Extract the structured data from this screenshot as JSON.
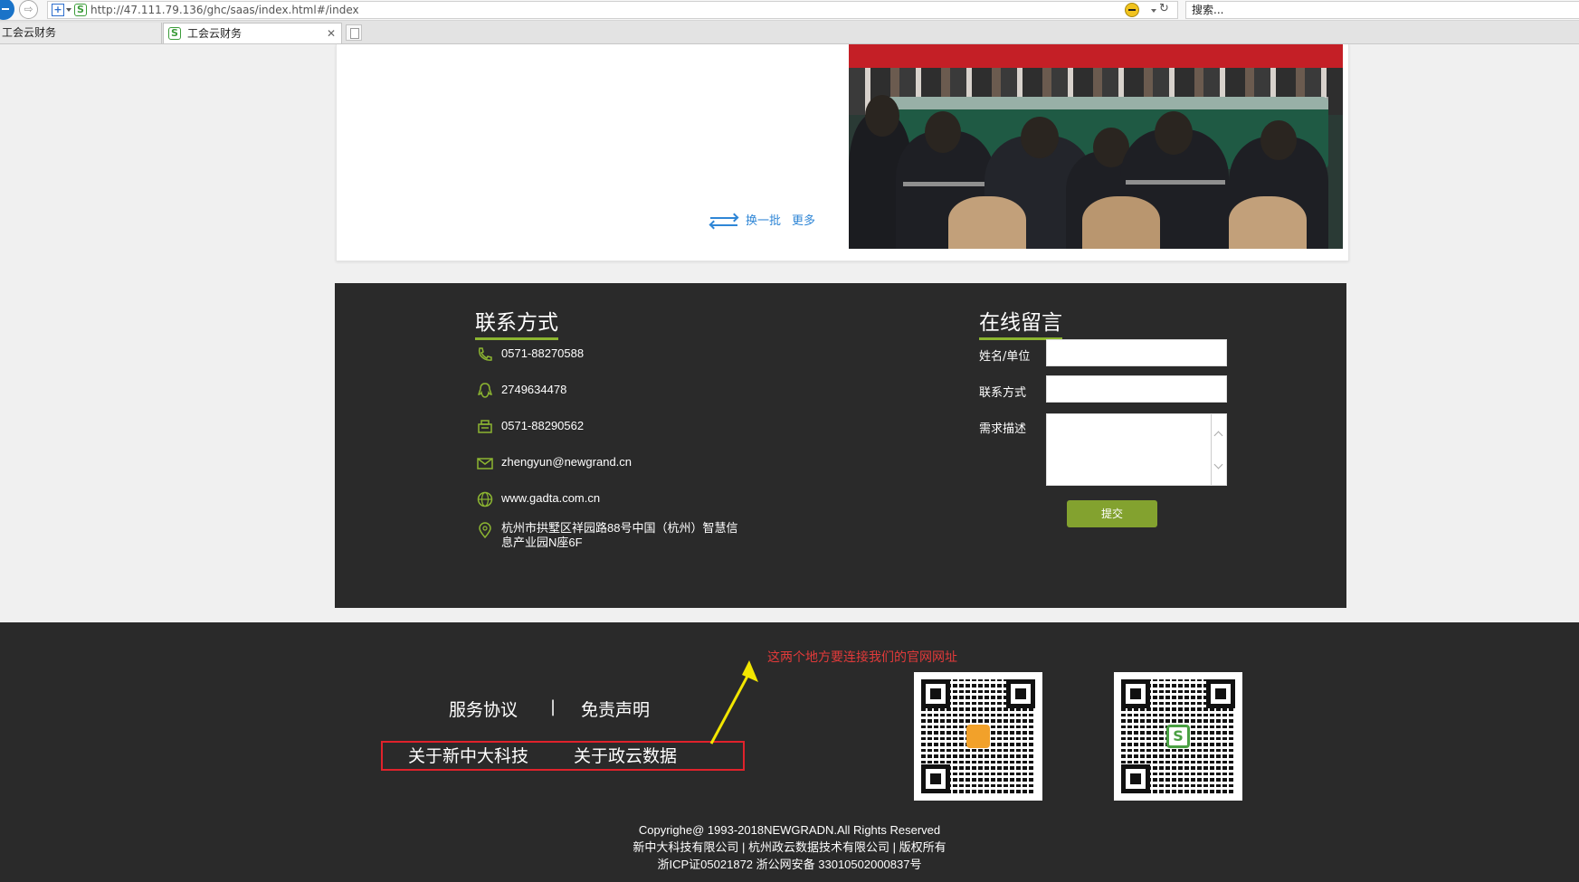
{
  "browser": {
    "url": "http://47.111.79.136/ghc/saas/index.html#/index",
    "url_host": "47.111.79.136",
    "search_placeholder": "搜索...",
    "tabs": [
      {
        "label": "工会云财务",
        "active": false
      },
      {
        "label": "工会云财务",
        "active": true
      }
    ]
  },
  "news": {
    "change_batch": "换一批",
    "more": "更多"
  },
  "contact": {
    "title": "联系方式",
    "items": [
      {
        "icon": "phone-icon",
        "text": "0571-88270588"
      },
      {
        "icon": "qq-icon",
        "text": "2749634478"
      },
      {
        "icon": "fax-icon",
        "text": "0571-88290562"
      },
      {
        "icon": "mail-icon",
        "text": "zhengyun@newgrand.cn"
      },
      {
        "icon": "globe-icon",
        "text": "www.gadta.com.cn"
      },
      {
        "icon": "location-icon",
        "text": "杭州市拱墅区祥园路88号中国（杭州）智慧信息产业园N座6F"
      }
    ]
  },
  "message": {
    "title": "在线留言",
    "name_label": "姓名/单位",
    "contact_label": "联系方式",
    "desc_label": "需求描述",
    "name_value": "",
    "contact_value": "",
    "desc_value": "",
    "submit": "提交"
  },
  "footer": {
    "service_agreement": "服务协议",
    "separator": "|",
    "disclaimer": "免责声明",
    "about_newgrand": "关于新中大科技",
    "about_zhengyun": "关于政云数据",
    "annotation": "这两个地方要连接我们的官网网址",
    "copyright_lines": [
      "Copyrighe@ 1993-2018NEWGRADN.All Rights Reserved",
      "新中大科技有限公司 | 杭州政云数据技术有限公司 | 版权所有",
      "浙ICP证05021872 浙公网安备 33010502000837号"
    ]
  },
  "colors": {
    "accent_green": "#83a22f",
    "link_blue": "#2f86d6",
    "annotation_red": "#e0222b",
    "panel_dark": "#2a2a2a"
  }
}
